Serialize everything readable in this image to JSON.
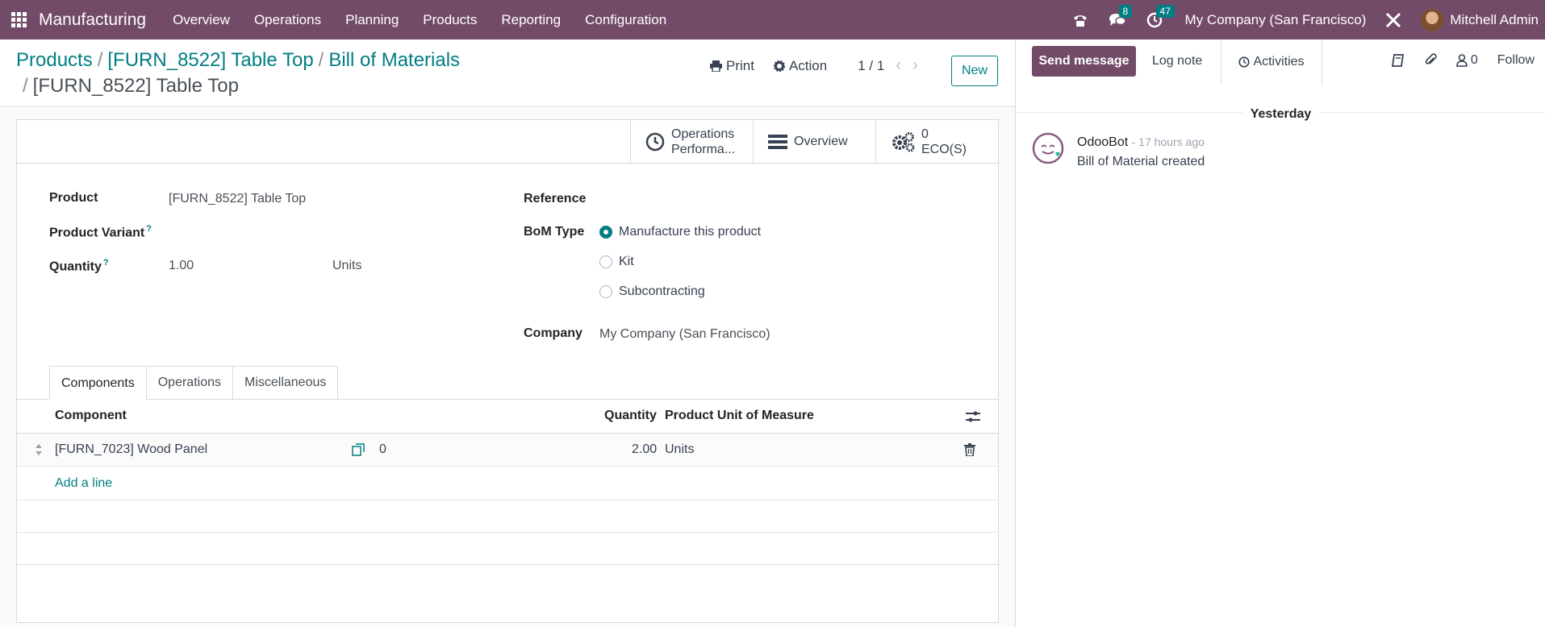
{
  "navbar": {
    "app_name": "Manufacturing",
    "menu": [
      "Overview",
      "Operations",
      "Planning",
      "Products",
      "Reporting",
      "Configuration"
    ],
    "messages_count": "8",
    "activities_count": "47",
    "company": "My Company (San Francisco)",
    "user": "Mitchell Admin"
  },
  "breadcrumb": {
    "items": [
      "Products",
      "[FURN_8522] Table Top",
      "Bill of Materials"
    ],
    "current": "[FURN_8522] Table Top"
  },
  "control": {
    "print": "Print",
    "action": "Action",
    "pager": "1 / 1",
    "new": "New"
  },
  "stat_buttons": {
    "ops_line1": "Operations",
    "ops_line2": "Performa...",
    "overview": "Overview",
    "eco_count": "0",
    "eco_label": "ECO(S)"
  },
  "form": {
    "product_label": "Product",
    "product_value": "[FURN_8522] Table Top",
    "variant_label": "Product Variant",
    "quantity_label": "Quantity",
    "quantity_value": "1.00",
    "quantity_uom": "Units",
    "reference_label": "Reference",
    "bom_type_label": "BoM Type",
    "bom_types": [
      "Manufacture this product",
      "Kit",
      "Subcontracting"
    ],
    "bom_type_selected": "Manufacture this product",
    "company_label": "Company",
    "company_value": "My Company (San Francisco)",
    "help_mark": "?"
  },
  "tabs": [
    "Components",
    "Operations",
    "Miscellaneous"
  ],
  "table": {
    "headers": {
      "component": "Component",
      "quantity": "Quantity",
      "uom": "Product Unit of Measure"
    },
    "rows": [
      {
        "component": "[FURN_7023] Wood Panel",
        "forecast": "0",
        "quantity": "2.00",
        "uom": "Units"
      }
    ],
    "add_line": "Add a line"
  },
  "chatter": {
    "send_message": "Send message",
    "log_note": "Log note",
    "activities": "Activities",
    "followers": "0",
    "follow": "Follow",
    "date_separator": "Yesterday",
    "message": {
      "author": "OdooBot",
      "time": "- 17 hours ago",
      "body": "Bill of Material created"
    }
  },
  "colors": {
    "brand": "#714B67",
    "accent": "#017e84"
  }
}
